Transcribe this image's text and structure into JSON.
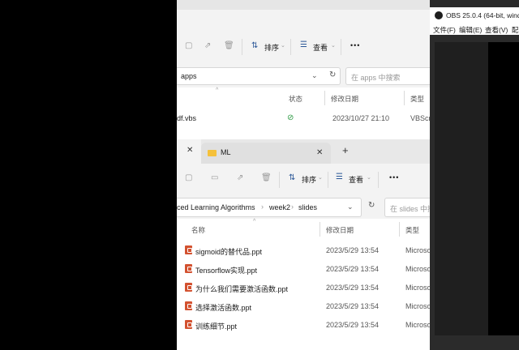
{
  "apps_window": {
    "toolbar": {
      "sort_label": "排序",
      "view_label": "查看",
      "more_label": "•••"
    },
    "address": {
      "path": "apps",
      "search_placeholder": "在 apps 中搜索"
    },
    "columns": {
      "status": "状态",
      "modified": "修改日期",
      "type": "类型"
    },
    "row": {
      "name": "df.vbs",
      "modified": "2023/10/27 21:10",
      "type": "VBScri"
    }
  },
  "ml_window": {
    "tabs": [
      {
        "label": ""
      },
      {
        "label": "ML"
      }
    ],
    "toolbar": {
      "sort_label": "排序",
      "view_label": "查看",
      "more_label": "•••"
    },
    "address": {
      "crumbs": [
        "ced Learning Algorithms",
        "week2",
        "slides"
      ],
      "search_placeholder": "在 slides 中搜索"
    },
    "columns": {
      "name": "名称",
      "modified": "修改日期",
      "type": "类型"
    },
    "files": [
      {
        "name": "sigmoid的替代品.ppt",
        "modified": "2023/5/29 13:54",
        "type": "Microso"
      },
      {
        "name": "Tensorflow实现.ppt",
        "modified": "2023/5/29 13:54",
        "type": "Microso"
      },
      {
        "name": "为什么我们需要激活函数.ppt",
        "modified": "2023/5/29 13:54",
        "type": "Microso"
      },
      {
        "name": "选择激活函数.ppt",
        "modified": "2023/5/29 13:54",
        "type": "Microso"
      },
      {
        "name": "训练细节.ppt",
        "modified": "2023/5/29 13:54",
        "type": "Microso"
      }
    ]
  },
  "obs_window": {
    "title": "OBS 25.0.4 (64-bit, windo",
    "menu": [
      "文件(F)",
      "编辑(E)",
      "查看(V)",
      "配"
    ]
  }
}
